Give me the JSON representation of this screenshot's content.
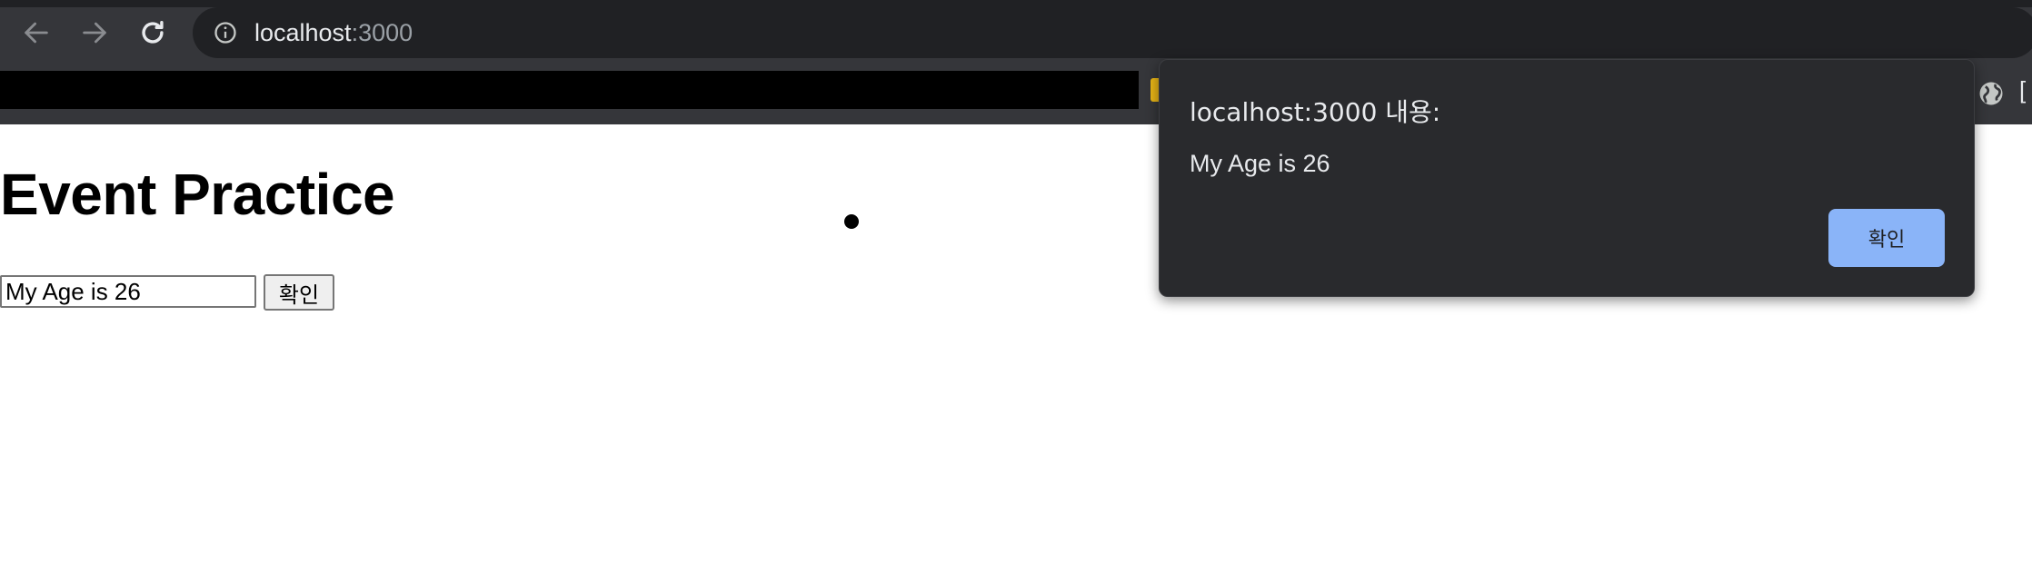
{
  "browser": {
    "url_host": "localhost",
    "url_port": ":3000",
    "icons": {
      "back": "arrow-left-icon",
      "forward": "arrow-right-icon",
      "reload": "reload-icon",
      "site_info": "info-icon",
      "globe": "globe-icon"
    },
    "bookmark_edge_text": "[",
    "colors": {
      "toolbar": "#35363a",
      "omnibox": "#202124"
    }
  },
  "page": {
    "title": "Event Practice",
    "input_value": "My Age is 26",
    "confirm_label": "확인"
  },
  "alert": {
    "title": "localhost:3000 내용:",
    "message": "My Age is 26",
    "ok_label": "확인",
    "colors": {
      "background": "#292a2d",
      "button": "#8ab4f8"
    }
  }
}
